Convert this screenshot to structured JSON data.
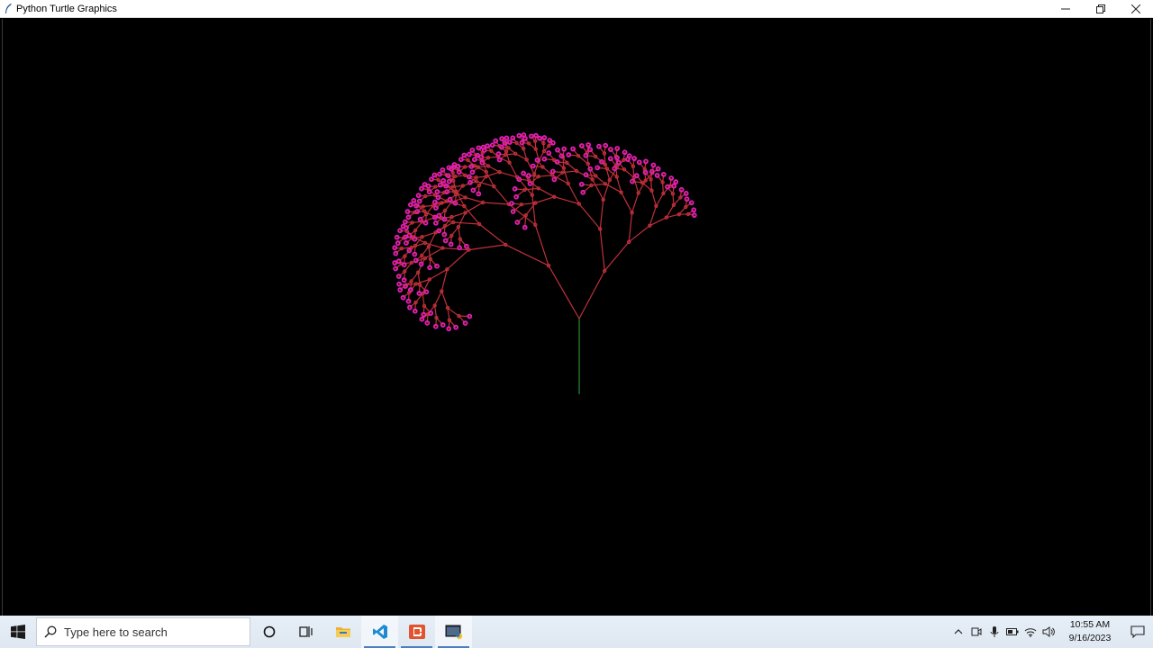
{
  "window": {
    "title": "Python Turtle Graphics",
    "icons": {
      "app": "turtle-feather-icon",
      "minimize": "minimize-icon",
      "maximize": "restore-icon",
      "close": "close-icon"
    }
  },
  "canvas": {
    "background": "#000000",
    "trunk_color": "#2e8b2e",
    "branch_color": "#c0303a",
    "leaf_color": "#e81ad0"
  },
  "taskbar": {
    "search_placeholder": "Type here to search",
    "clock_time": "10:55 AM",
    "clock_date": "9/16/2023",
    "accent_color": "#4a7fc1",
    "pinned": [
      "cortana-icon",
      "task-view-icon",
      "file-explorer-icon",
      "vscode-icon",
      "app-orange-icon",
      "python-turtle-icon"
    ],
    "tray": [
      "chevron-up-icon",
      "meet-icon",
      "microphone-icon",
      "battery-icon",
      "wifi-icon",
      "volume-icon",
      "notification-icon"
    ]
  }
}
